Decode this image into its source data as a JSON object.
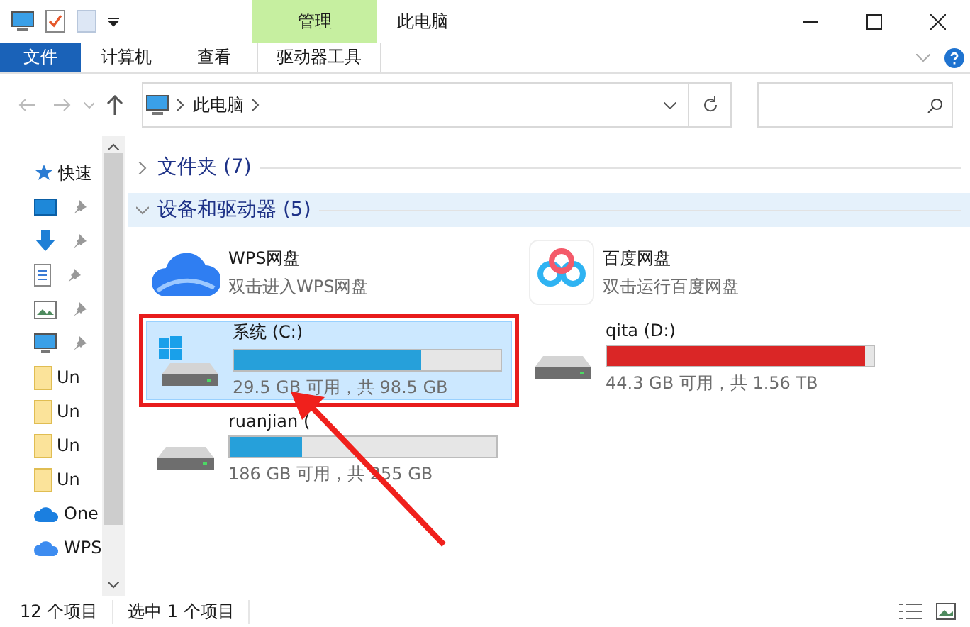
{
  "window": {
    "title": "此电脑",
    "context_group": "管理"
  },
  "ribbon_tabs": [
    {
      "label": "文件",
      "kind": "file"
    },
    {
      "label": "计算机",
      "kind": "plain"
    },
    {
      "label": "查看",
      "kind": "plain"
    },
    {
      "label": "驱动器工具",
      "kind": "context"
    }
  ],
  "address": {
    "path": [
      "此电脑"
    ]
  },
  "nav_pane": [
    {
      "label": "快速",
      "kind": "star",
      "pinned": false
    },
    {
      "kind": "desktop",
      "pinned": true
    },
    {
      "kind": "download",
      "pinned": true
    },
    {
      "kind": "document",
      "pinned": true
    },
    {
      "kind": "image",
      "pinned": true
    },
    {
      "kind": "monitor",
      "pinned": true
    },
    {
      "label": "Un",
      "kind": "folder",
      "pinned": false
    },
    {
      "label": "Un",
      "kind": "folder",
      "pinned": false
    },
    {
      "label": "Un",
      "kind": "folder",
      "pinned": false
    },
    {
      "label": "Un",
      "kind": "folder",
      "pinned": false
    },
    {
      "label": "One",
      "kind": "onedrive",
      "pinned": false
    },
    {
      "label": "WPS",
      "kind": "wps",
      "pinned": false
    }
  ],
  "groups": [
    {
      "title": "文件夹 (7)",
      "expanded": false
    },
    {
      "title": "设备和驱动器 (5)",
      "expanded": true,
      "items": [
        {
          "kind": "wps-app",
          "name": "WPS网盘",
          "subtitle": "双击进入WPS网盘",
          "selected": false
        },
        {
          "kind": "baidu-app",
          "name": "百度网盘",
          "subtitle": "双击运行百度网盘",
          "selected": false
        },
        {
          "kind": "system-drive",
          "name": "系统 (C:)",
          "level": 0.7,
          "size": "29.5 GB 可用，共 98.5 GB",
          "selected": true,
          "framed": true
        },
        {
          "kind": "drive",
          "name": "qita (D:)",
          "level": 0.97,
          "size": "44.3 GB 可用，共 1.56 TB",
          "selected": false,
          "framed": false
        },
        {
          "kind": "drive",
          "name": "ruanjian (",
          "level": 0.27,
          "size": "186 GB 可用，共 255 GB",
          "selected": false,
          "framed": false
        }
      ]
    }
  ],
  "annotations": [
    {
      "kind": "arrow"
    }
  ],
  "status_bar": {
    "count": "12 个项目",
    "selection": "选中 1 个项目"
  }
}
